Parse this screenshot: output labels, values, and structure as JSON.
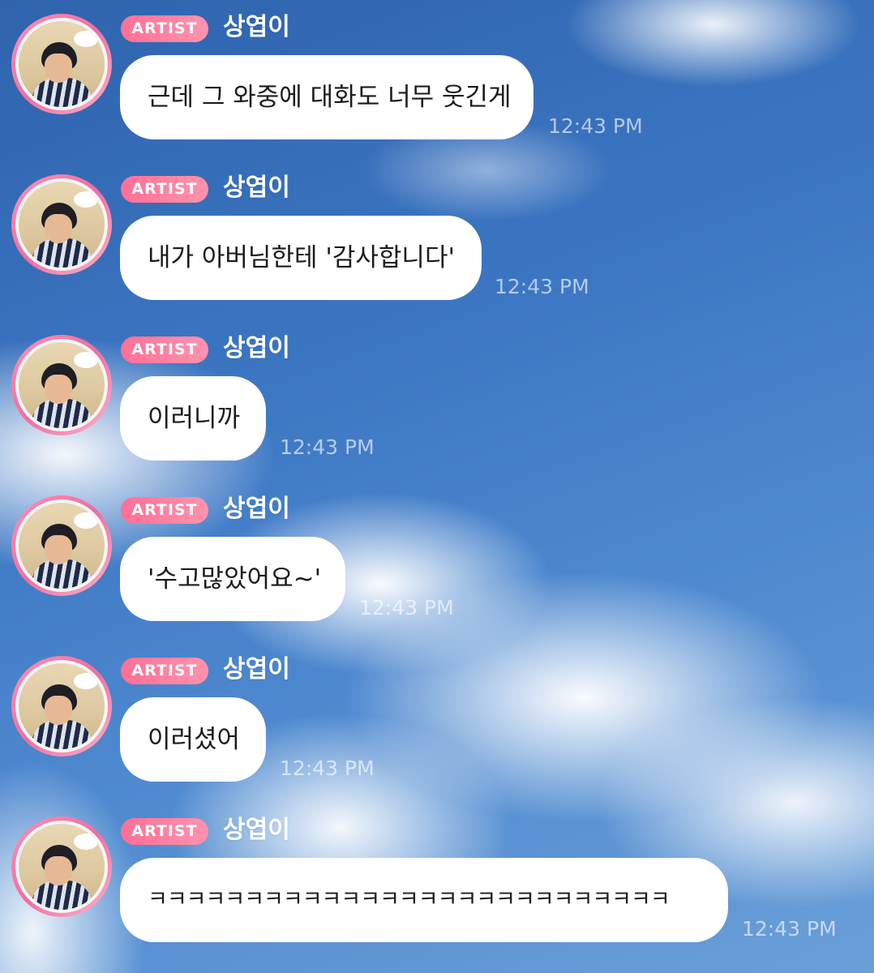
{
  "chat": {
    "messages": [
      {
        "badge": "ARTIST",
        "sender": "상엽이",
        "text": "근데 그 와중에 대화도 너무 웃긴게",
        "time": "12:43 PM"
      },
      {
        "badge": "ARTIST",
        "sender": "상엽이",
        "text": "내가 아버님한테 '감사합니다'",
        "time": "12:43 PM"
      },
      {
        "badge": "ARTIST",
        "sender": "상엽이",
        "text": "이러니까",
        "time": "12:43 PM"
      },
      {
        "badge": "ARTIST",
        "sender": "상엽이",
        "text": "'수고많았어요~'",
        "time": "12:43 PM"
      },
      {
        "badge": "ARTIST",
        "sender": "상엽이",
        "text": "이러셨어",
        "time": "12:43 PM"
      },
      {
        "badge": "ARTIST",
        "sender": "상엽이",
        "text": "ㅋㅋㅋㅋㅋㅋㅋㅋㅋㅋㅋㅋㅋㅋㅋㅋㅋㅋㅋㅋㅋㅋㅋㅋㅋㅋㅋ",
        "time": "12:43 PM"
      }
    ]
  },
  "colors": {
    "badge": "#ff7a9c",
    "avatar_ring": "#f06ea0",
    "bubble": "#ffffff",
    "sky": "#3b75c2"
  },
  "icons": {
    "avatar": "profile-photo"
  }
}
